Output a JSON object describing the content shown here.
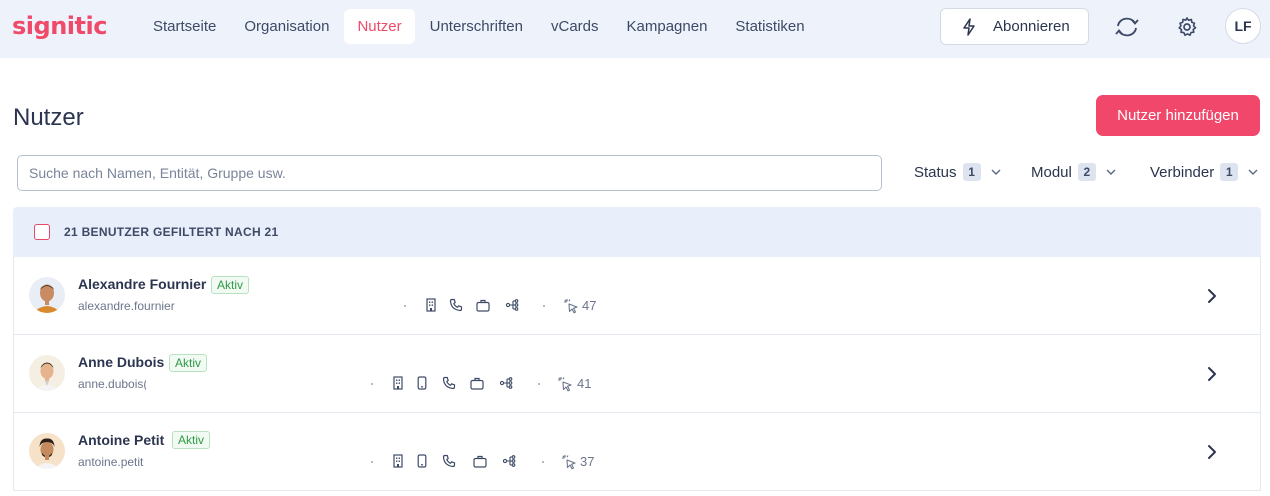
{
  "app": {
    "logo": "signitic"
  },
  "nav": [
    {
      "label": "Startseite"
    },
    {
      "label": "Organisation"
    },
    {
      "label": "Nutzer"
    },
    {
      "label": "Unterschriften"
    },
    {
      "label": "vCards"
    },
    {
      "label": "Kampagnen"
    },
    {
      "label": "Statistiken"
    }
  ],
  "header": {
    "subscribe": "Abonnieren",
    "avatar_initials": "LF"
  },
  "page": {
    "title": "Nutzer",
    "add_button": "Nutzer hinzufügen"
  },
  "search": {
    "placeholder": "Suche nach Namen, Entität, Gruppe usw.",
    "value": ""
  },
  "filters": [
    {
      "label": "Status",
      "count": "1"
    },
    {
      "label": "Modul",
      "count": "2"
    },
    {
      "label": "Verbinder",
      "count": "1"
    }
  ],
  "list": {
    "summary": "21 BENUTZER GEFILTERT NACH 21"
  },
  "users": [
    {
      "name": "Alexandre Fournier",
      "status": "Aktiv",
      "email": "alexandre.fournier",
      "clicks": "47"
    },
    {
      "name": "Anne Dubois",
      "status": "Aktiv",
      "email": "anne.dubois(",
      "clicks": "41"
    },
    {
      "name": "Antoine Petit",
      "status": "Aktiv",
      "email": "antoine.petit",
      "clicks": "37"
    }
  ],
  "colors": {
    "brand": "#ef4a6a",
    "primary_button": "#f0476a",
    "nav_bg": "#eef3fb",
    "active_badge": "#2f9a46"
  },
  "icons": [
    "zap-icon",
    "sync-icon",
    "gear-icon",
    "chevron-down-icon",
    "building-icon",
    "mobile-icon",
    "phone-icon",
    "briefcase-icon",
    "hierarchy-icon",
    "cursor-click-icon",
    "chevron-right-icon"
  ]
}
